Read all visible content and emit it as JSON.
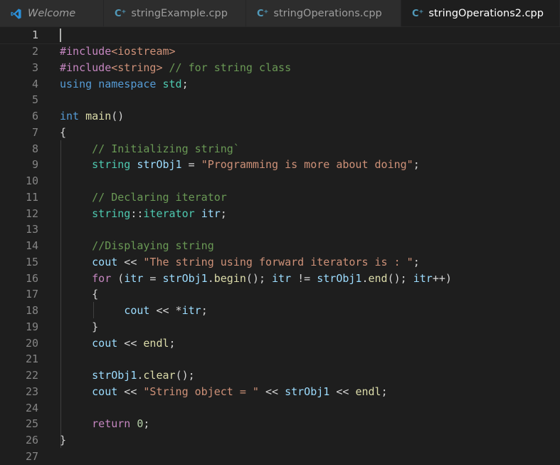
{
  "tabs": [
    {
      "label": "Welcome",
      "icon": "vscode-icon",
      "italic": true,
      "dot": false,
      "active": false
    },
    {
      "label": "stringExample.cpp",
      "icon": "cpp-file-icon",
      "dot": true,
      "active": false
    },
    {
      "label": "stringOperations.cpp",
      "icon": "cpp-file-icon",
      "dot": true,
      "active": false
    },
    {
      "label": "stringOperations2.cpp",
      "icon": "cpp-file-icon",
      "dot": true,
      "active": true
    }
  ],
  "colors": {
    "preprocessor": "#c586c0",
    "include_path": "#ce9178",
    "comment": "#6a9955",
    "keyword": "#569cd6",
    "control": "#c586c0",
    "type": "#4ec9b0",
    "function": "#dcdcaa",
    "variable": "#9cdcfe",
    "string": "#ce9178",
    "number": "#b5cea8"
  },
  "editor": {
    "current_line": 1,
    "lines": [
      {
        "n": "1",
        "tokens": []
      },
      {
        "n": "2",
        "tokens": [
          [
            "pre",
            "#include"
          ],
          [
            "inc",
            "<iostream>"
          ]
        ]
      },
      {
        "n": "3",
        "tokens": [
          [
            "pre",
            "#include"
          ],
          [
            "inc",
            "<string>"
          ],
          [
            "txt",
            " "
          ],
          [
            "com",
            "// for string class"
          ]
        ]
      },
      {
        "n": "4",
        "tokens": [
          [
            "kw",
            "using"
          ],
          [
            "txt",
            " "
          ],
          [
            "kw",
            "namespace"
          ],
          [
            "txt",
            " "
          ],
          [
            "type",
            "std"
          ],
          [
            "txt",
            ";"
          ]
        ]
      },
      {
        "n": "5",
        "tokens": []
      },
      {
        "n": "6",
        "tokens": [
          [
            "kw",
            "int"
          ],
          [
            "txt",
            " "
          ],
          [
            "fn",
            "main"
          ],
          [
            "txt",
            "()"
          ]
        ]
      },
      {
        "n": "7",
        "tokens": [
          [
            "txt",
            "{"
          ]
        ]
      },
      {
        "n": "8",
        "tokens": [
          [
            "txt",
            "     "
          ],
          [
            "com",
            "// Initializing string`"
          ]
        ]
      },
      {
        "n": "9",
        "tokens": [
          [
            "txt",
            "     "
          ],
          [
            "type",
            "string"
          ],
          [
            "txt",
            " "
          ],
          [
            "var",
            "strObj1"
          ],
          [
            "txt",
            " = "
          ],
          [
            "str",
            "\"Programming is more about doing\""
          ],
          [
            "txt",
            ";"
          ]
        ]
      },
      {
        "n": "10",
        "tokens": []
      },
      {
        "n": "11",
        "tokens": [
          [
            "txt",
            "     "
          ],
          [
            "com",
            "// Declaring iterator"
          ]
        ]
      },
      {
        "n": "12",
        "tokens": [
          [
            "txt",
            "     "
          ],
          [
            "type",
            "string"
          ],
          [
            "txt",
            "::"
          ],
          [
            "type",
            "iterator"
          ],
          [
            "txt",
            " "
          ],
          [
            "var",
            "itr"
          ],
          [
            "txt",
            ";"
          ]
        ]
      },
      {
        "n": "13",
        "tokens": []
      },
      {
        "n": "14",
        "tokens": [
          [
            "txt",
            "     "
          ],
          [
            "com",
            "//Displaying string"
          ]
        ]
      },
      {
        "n": "15",
        "tokens": [
          [
            "txt",
            "     "
          ],
          [
            "var",
            "cout"
          ],
          [
            "txt",
            " << "
          ],
          [
            "str",
            "\"The string using forward iterators is : \""
          ],
          [
            "txt",
            ";"
          ]
        ]
      },
      {
        "n": "16",
        "tokens": [
          [
            "txt",
            "     "
          ],
          [
            "ctl",
            "for"
          ],
          [
            "txt",
            " ("
          ],
          [
            "var",
            "itr"
          ],
          [
            "txt",
            " = "
          ],
          [
            "var",
            "strObj1"
          ],
          [
            "txt",
            "."
          ],
          [
            "fn",
            "begin"
          ],
          [
            "txt",
            "(); "
          ],
          [
            "var",
            "itr"
          ],
          [
            "txt",
            " != "
          ],
          [
            "var",
            "strObj1"
          ],
          [
            "txt",
            "."
          ],
          [
            "fn",
            "end"
          ],
          [
            "txt",
            "(); "
          ],
          [
            "var",
            "itr"
          ],
          [
            "txt",
            "++)"
          ]
        ]
      },
      {
        "n": "17",
        "tokens": [
          [
            "txt",
            "     {"
          ]
        ]
      },
      {
        "n": "18",
        "tokens": [
          [
            "txt",
            "          "
          ],
          [
            "var",
            "cout"
          ],
          [
            "txt",
            " << *"
          ],
          [
            "var",
            "itr"
          ],
          [
            "txt",
            ";"
          ]
        ]
      },
      {
        "n": "19",
        "tokens": [
          [
            "txt",
            "     }"
          ]
        ]
      },
      {
        "n": "20",
        "tokens": [
          [
            "txt",
            "     "
          ],
          [
            "var",
            "cout"
          ],
          [
            "txt",
            " << "
          ],
          [
            "fn",
            "endl"
          ],
          [
            "txt",
            ";"
          ]
        ]
      },
      {
        "n": "21",
        "tokens": []
      },
      {
        "n": "22",
        "tokens": [
          [
            "txt",
            "     "
          ],
          [
            "var",
            "strObj1"
          ],
          [
            "txt",
            "."
          ],
          [
            "fn",
            "clear"
          ],
          [
            "txt",
            "();"
          ]
        ]
      },
      {
        "n": "23",
        "tokens": [
          [
            "txt",
            "     "
          ],
          [
            "var",
            "cout"
          ],
          [
            "txt",
            " << "
          ],
          [
            "str",
            "\"String object = \""
          ],
          [
            "txt",
            " << "
          ],
          [
            "var",
            "strObj1"
          ],
          [
            "txt",
            " << "
          ],
          [
            "fn",
            "endl"
          ],
          [
            "txt",
            ";"
          ]
        ]
      },
      {
        "n": "24",
        "tokens": []
      },
      {
        "n": "25",
        "tokens": [
          [
            "txt",
            "     "
          ],
          [
            "ctl",
            "return"
          ],
          [
            "txt",
            " "
          ],
          [
            "num",
            "0"
          ],
          [
            "txt",
            ";"
          ]
        ]
      },
      {
        "n": "26",
        "tokens": [
          [
            "txt",
            "}"
          ]
        ]
      },
      {
        "n": "27",
        "tokens": []
      }
    ]
  }
}
